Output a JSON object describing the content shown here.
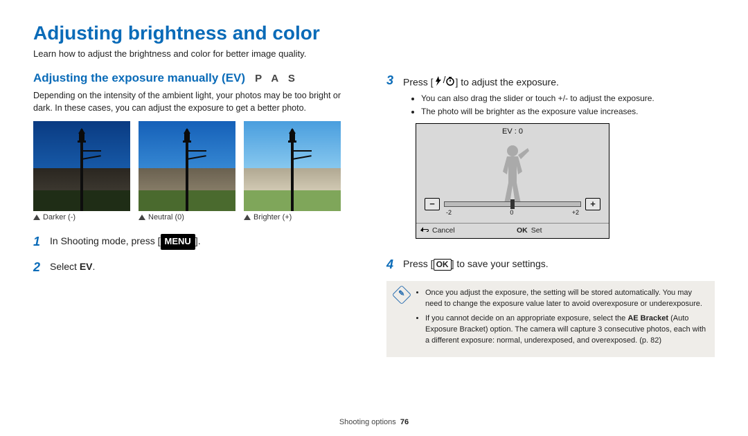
{
  "page": {
    "title": "Adjusting brightness and color",
    "intro": "Learn how to adjust the brightness and color for better image quality."
  },
  "section": {
    "title": "Adjusting the exposure manually (EV)",
    "modes": "P A S",
    "desc": "Depending on the intensity of the ambient light, your photos may be too bright or dark. In these cases, you can adjust the exposure to get a better photo."
  },
  "examples": [
    {
      "caption": "Darker (-)"
    },
    {
      "caption": "Neutral (0)"
    },
    {
      "caption": "Brighter (+)"
    }
  ],
  "steps_left": [
    {
      "n": "1",
      "pre": "In Shooting mode, press [",
      "badge": "MENU",
      "post": "]."
    },
    {
      "n": "2",
      "pre": "Select ",
      "bold": "EV",
      "post": "."
    }
  ],
  "steps_right": [
    {
      "n": "3",
      "pre": "Press [",
      "icons": true,
      "post": "] to adjust the exposure.",
      "bullets": [
        "You can also drag the slider or touch +/- to adjust the exposure.",
        "The photo will be brighter as the exposure value increases."
      ]
    },
    {
      "n": "4",
      "pre": "Press [",
      "ok": "OK",
      "post": "] to save your settings."
    }
  ],
  "ev_screen": {
    "label": "EV : 0",
    "scale": {
      "min": "-2",
      "mid": "0",
      "max": "+2"
    },
    "minus": "−",
    "plus": "+",
    "cancel": "Cancel",
    "set": "Set",
    "ok": "OK"
  },
  "note": {
    "items": [
      "Once you adjust the exposure, the setting will be stored automatically. You may need to change the exposure value later to avoid overexposure or underexposure.",
      "If you cannot decide on an appropriate exposure, select the <b>AE Bracket</b> (Auto Exposure Bracket) option. The camera will capture 3 consecutive photos, each with a different exposure: normal, underexposed, and overexposed. (p. 82)"
    ]
  },
  "footer": {
    "section": "Shooting options",
    "page": "76"
  }
}
